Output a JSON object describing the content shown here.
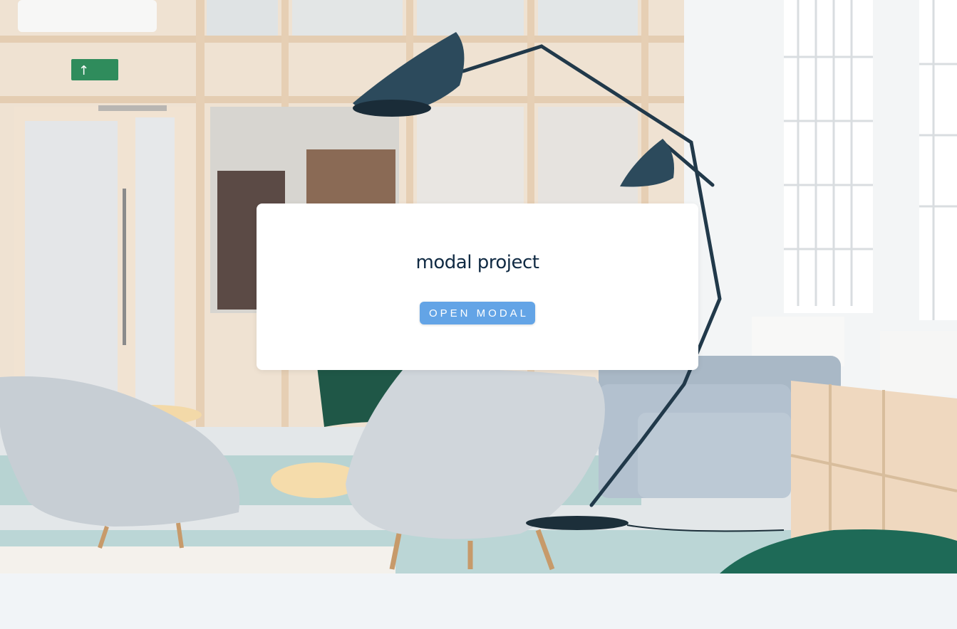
{
  "hero": {
    "scene": "interior-office-lounge-photo",
    "exit_sign_icon": "exit-sign-icon"
  },
  "modal_card": {
    "title": "modal project",
    "open_button_label": "OPEN MODAL"
  },
  "colors": {
    "page_background": "#f1f4f7",
    "card_background": "#ffffff",
    "title_color": "#102a43",
    "button_color": "#63a4e6",
    "button_text": "#ffffff"
  }
}
